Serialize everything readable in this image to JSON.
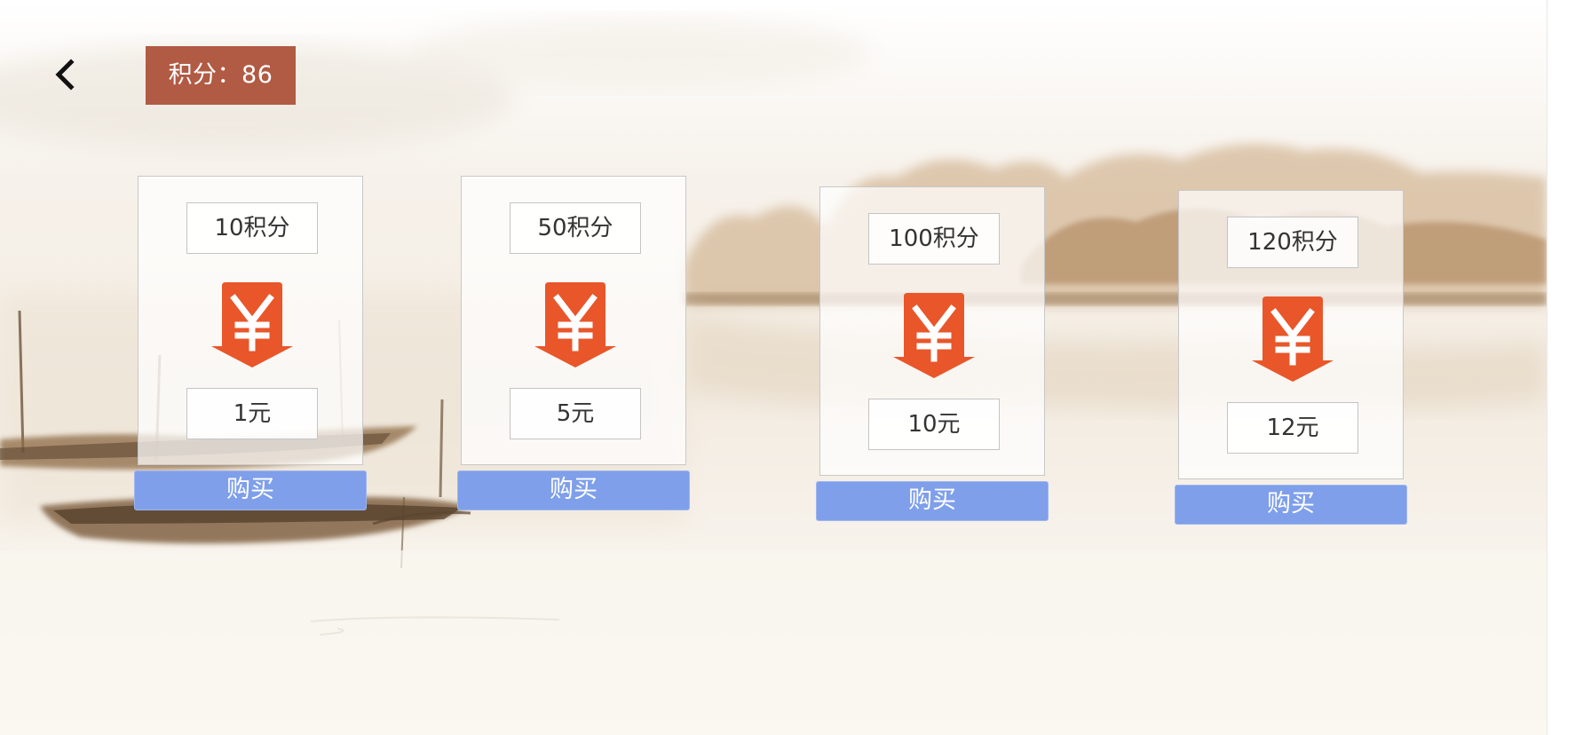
{
  "header": {
    "back_icon": "chevron-left-icon",
    "points_label": "积分：86"
  },
  "packages": [
    {
      "points": "10积分",
      "price": "1元",
      "buy_label": "购买"
    },
    {
      "points": "50积分",
      "price": "5元",
      "buy_label": "购买"
    },
    {
      "points": "100积分",
      "price": "10元",
      "buy_label": "购买"
    },
    {
      "points": "120积分",
      "price": "12元",
      "buy_label": "购买"
    }
  ],
  "icons": {
    "currency": "yen-download-icon"
  },
  "colors": {
    "badge_bg": "#b15a44",
    "icon_orange": "#e8562a",
    "buy_button": "#7f9fea",
    "ink_wash": "#b58d64"
  }
}
